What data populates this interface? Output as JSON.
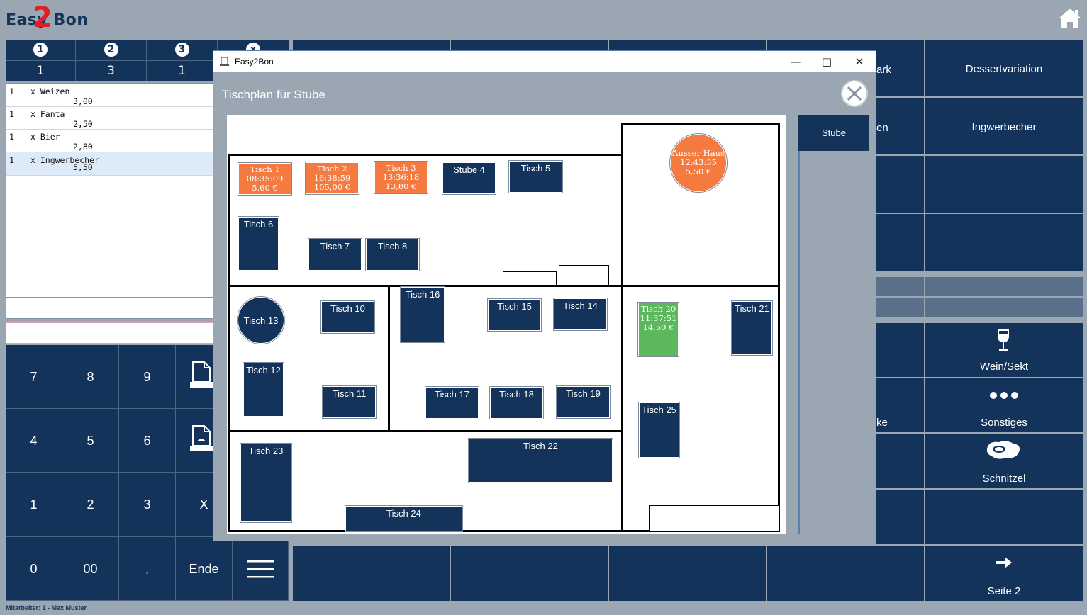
{
  "app": {
    "logo_text": "Easy Bon",
    "logo_digit": "2"
  },
  "counters": [
    {
      "index": "1",
      "value": "1"
    },
    {
      "index": "2",
      "value": "3"
    },
    {
      "index": "3",
      "value": "1"
    },
    {
      "index": "x",
      "value": ""
    }
  ],
  "receipt": [
    {
      "qty": "1",
      "name": "x Weizen",
      "price": "3,00"
    },
    {
      "qty": "1",
      "name": "x Fanta",
      "price": "2,50"
    },
    {
      "qty": "1",
      "name": "x Bier",
      "price": "2,80"
    },
    {
      "qty": "1",
      "name": "x Ingwerbecher",
      "price": "5,50"
    }
  ],
  "keypad": {
    "k7": "7",
    "k8": "8",
    "k9": "9",
    "k4": "4",
    "k5": "5",
    "k6": "6",
    "k1": "1",
    "k2": "2",
    "k3": "3",
    "kx": "X",
    "k0": "0",
    "k00": "00",
    "kcomma": ",",
    "kende": "Ende"
  },
  "products": {
    "r1": "Dessertvariation",
    "r2": "Ingwerbecher",
    "partial_ark": "ark",
    "partial_en": "en",
    "partial_ke": "ke",
    "wein": "Wein/Sekt",
    "sonstiges": "Sonstiges",
    "schnitzel": "Schnitzel",
    "seite2": "Seite 2"
  },
  "footer": {
    "employee": "Mitarbeiter: 1 - Max Muster"
  },
  "dialog": {
    "window_title": "Easy2Bon",
    "plan_title": "Tischplan für Stube",
    "room_button": "Stube",
    "tables": {
      "t1": {
        "name": "Tisch 1",
        "time": "08:35:09",
        "amount": "5,60 €"
      },
      "t2": {
        "name": "Tisch 2",
        "time": "16:38:59",
        "amount": "105,00 €"
      },
      "t3": {
        "name": "Tisch 3",
        "time": "13:36:18",
        "amount": "13,80 €"
      },
      "t4": {
        "name": "Stube 4"
      },
      "t5": {
        "name": "Tisch 5"
      },
      "t6": {
        "name": "Tisch 6"
      },
      "t7": {
        "name": "Tisch 7"
      },
      "t8": {
        "name": "Tisch 8"
      },
      "t10": {
        "name": "Tisch 10"
      },
      "t11": {
        "name": "Tisch 11"
      },
      "t12": {
        "name": "Tisch 12"
      },
      "t13": {
        "name": "Tisch 13"
      },
      "t14": {
        "name": "Tisch 14"
      },
      "t15": {
        "name": "Tisch 15"
      },
      "t16": {
        "name": "Tisch 16"
      },
      "t17": {
        "name": "Tisch 17"
      },
      "t18": {
        "name": "Tisch 18"
      },
      "t19": {
        "name": "Tisch 19"
      },
      "t20": {
        "name": "Tisch 20",
        "time": "11:37:51",
        "amount": "14,50 €"
      },
      "t21": {
        "name": "Tisch 21"
      },
      "t22": {
        "name": "Tisch 22"
      },
      "t23": {
        "name": "Tisch 23"
      },
      "t24": {
        "name": "Tisch 24"
      },
      "t25": {
        "name": "Tisch 25"
      },
      "ausser": {
        "name": "Ausser Haus",
        "time": "12:43:35",
        "amount": "5,50 €"
      }
    }
  },
  "colors": {
    "navy": "#13335b",
    "background": "#9aa6b2",
    "occupied": "#f47a3f",
    "ready": "#5cb85c"
  }
}
